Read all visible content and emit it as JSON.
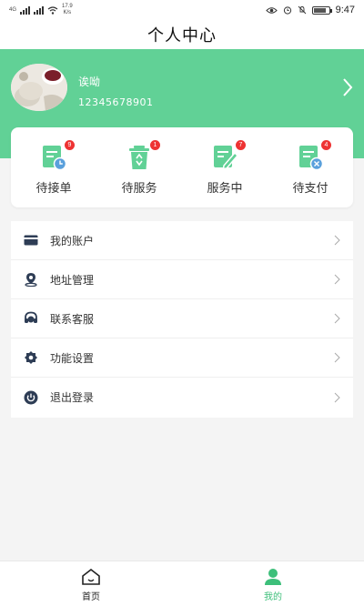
{
  "status_bar": {
    "left_carrier": "4G",
    "network_speed_value": "17.9",
    "network_speed_unit": "K/s",
    "time": "9:47"
  },
  "header": {
    "title": "个人中心"
  },
  "profile": {
    "name": "诶呦",
    "phone": "12345678901"
  },
  "orders": [
    {
      "label": "待接单",
      "badge": "9"
    },
    {
      "label": "待服务",
      "badge": "1"
    },
    {
      "label": "服务中",
      "badge": "7"
    },
    {
      "label": "待支付",
      "badge": "4"
    }
  ],
  "menu": [
    {
      "label": "我的账户",
      "icon": "card-icon"
    },
    {
      "label": "地址管理",
      "icon": "location-icon"
    },
    {
      "label": "联系客服",
      "icon": "headset-icon"
    },
    {
      "label": "功能设置",
      "icon": "settings-icon"
    },
    {
      "label": "退出登录",
      "icon": "power-icon"
    }
  ],
  "tabs": [
    {
      "label": "首页",
      "icon": "home-icon",
      "active": false
    },
    {
      "label": "我的",
      "icon": "user-icon",
      "active": true
    }
  ],
  "colors": {
    "brand_green": "#61d196",
    "badge_red": "#e33333",
    "active_tab": "#3dbf7a",
    "menu_icon": "#2e3d55"
  }
}
